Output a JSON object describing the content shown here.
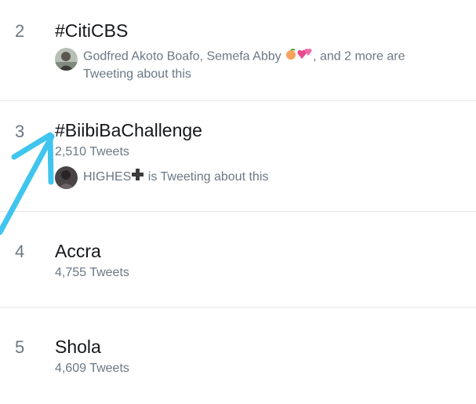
{
  "trends": [
    {
      "rank": "2",
      "name": "#CitiCBS",
      "context_people": "Godfred Akoto Boafo, Semefa Abby",
      "context_suffix": ", and 2 more are Tweeting about this",
      "avatar_icon": "profile-photo-icon",
      "emoji_icons": [
        "peach-icon",
        "two-hearts-icon"
      ]
    },
    {
      "rank": "3",
      "name": "#BiibiBaChallenge",
      "tweets": "2,510 Tweets",
      "context_people": "HIGHES",
      "context_suffix": " is Tweeting about this",
      "avatar_icon": "profile-photo-icon",
      "emoji_icons": [
        "heavy-plus-icon"
      ]
    },
    {
      "rank": "4",
      "name": "Accra",
      "tweets": "4,755 Tweets"
    },
    {
      "rank": "5",
      "name": "Shola",
      "tweets": "4,609 Tweets"
    }
  ],
  "annotation": {
    "icon": "blue-arrow-annotation-icon",
    "color": "#3fc5ee"
  },
  "colors": {
    "primary_text": "#141619",
    "secondary_text": "#6b7884",
    "divider": "#e4e7ea"
  }
}
